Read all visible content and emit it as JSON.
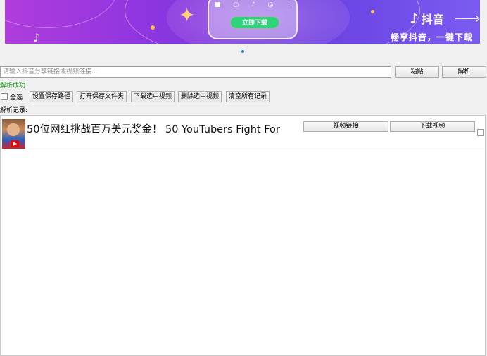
{
  "banner": {
    "download_button": "立即下载",
    "brand_name": "抖音",
    "tagline": "畅享抖音，一键下载"
  },
  "input": {
    "placeholder": "请输入抖音分享链接或视频链接...",
    "value": ""
  },
  "buttons": {
    "paste": "粘贴",
    "parse": "解析"
  },
  "status": {
    "text": "解析成功",
    "color": "#0a8a0a"
  },
  "toolbar": {
    "select_all": "全选",
    "set_save_path": "设置保存路径",
    "open_save_folder": "打开保存文件夹",
    "download_selected": "下载选中视频",
    "delete_selected": "删除选中视频",
    "clear_all": "清空所有记录"
  },
  "records": {
    "label": "解析记录:",
    "items": [
      {
        "title": "50位网红挑战百万美元奖金！ 50 YouTubers Fight For",
        "link_button": "视频链接",
        "download_button": "下载视频"
      }
    ]
  }
}
